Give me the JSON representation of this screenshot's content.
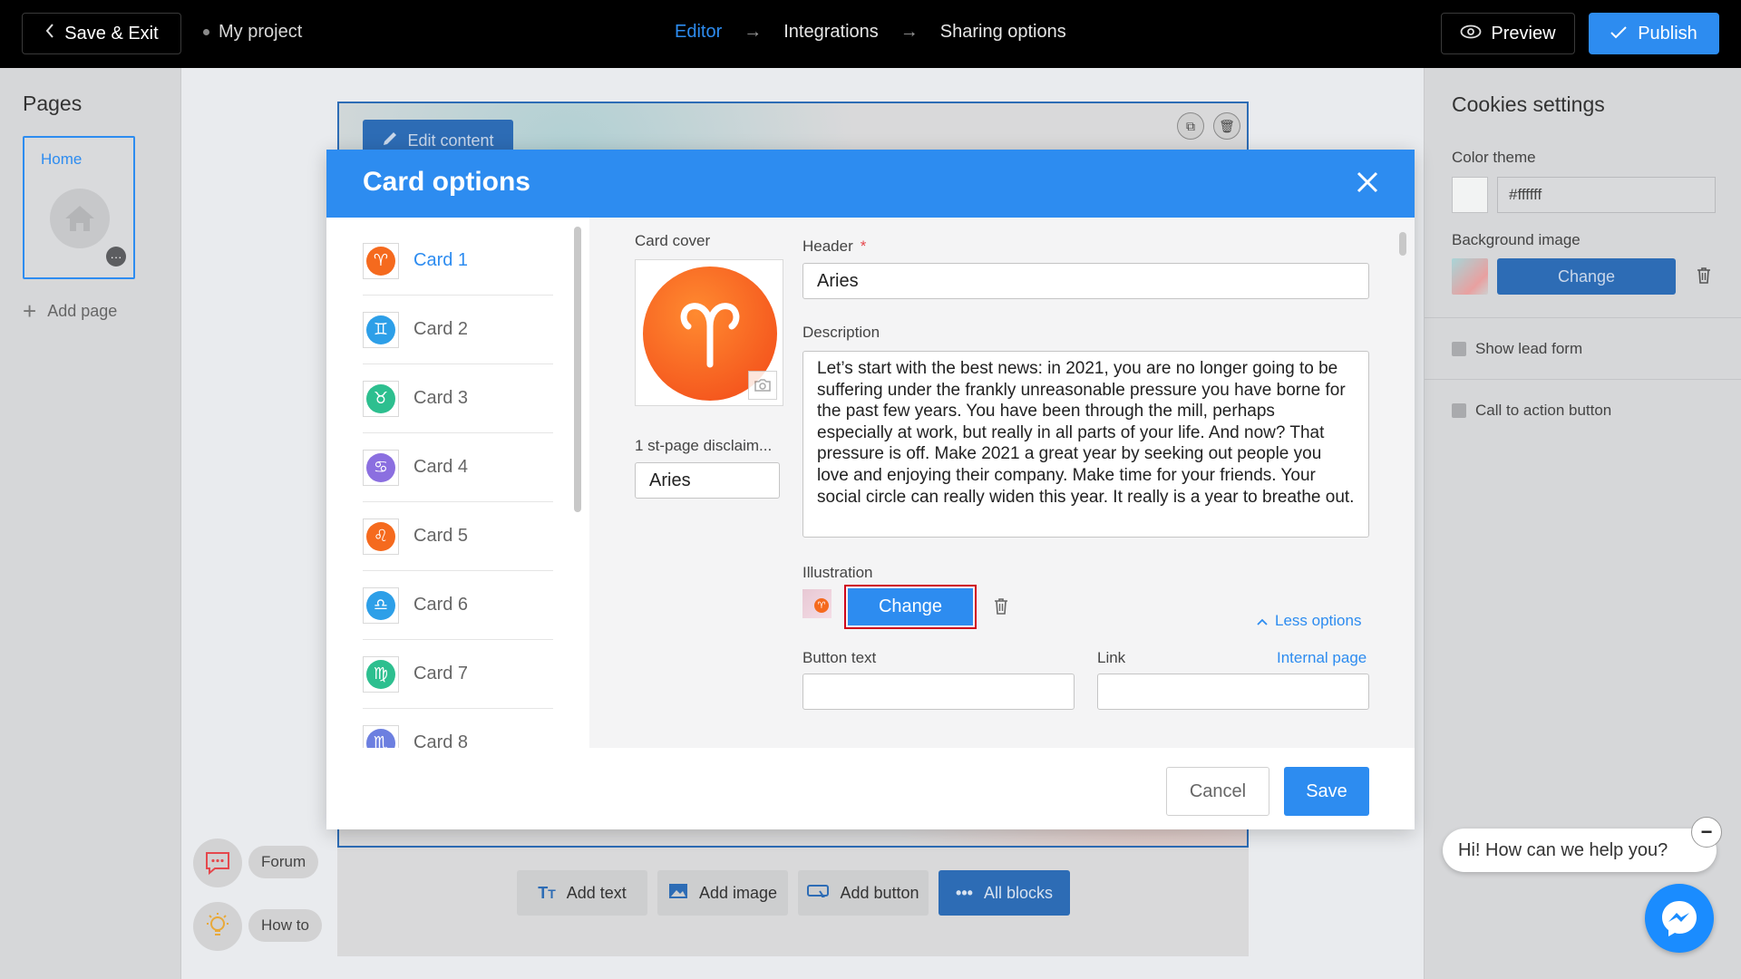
{
  "topbar": {
    "save_exit_label": "Save & Exit",
    "project_name": "My project",
    "steps": [
      "Editor",
      "Integrations",
      "Sharing options"
    ],
    "preview_label": "Preview",
    "publish_label": "Publish"
  },
  "left_sidebar": {
    "title": "Pages",
    "home_label": "Home",
    "add_page_label": "Add page"
  },
  "canvas": {
    "edit_content_label": "Edit content",
    "blocks": [
      {
        "label": "Add text",
        "icon": "text-icon"
      },
      {
        "label": "Add image",
        "icon": "image-icon"
      },
      {
        "label": "Add button",
        "icon": "button-icon"
      },
      {
        "label": "All blocks",
        "icon": "dots-icon"
      }
    ]
  },
  "help": {
    "forum_label": "Forum",
    "howto_label": "How to"
  },
  "right_sidebar": {
    "title": "Cookies settings",
    "color_theme_label": "Color theme",
    "color_value": "#ffffff",
    "background_image_label": "Background image",
    "change_label": "Change",
    "show_lead_form_label": "Show lead form",
    "cta_label": "Call to action button"
  },
  "chat": {
    "prompt": "Hi! How can we help you?"
  },
  "modal": {
    "title": "Card options",
    "cards": [
      {
        "label": "Card 1",
        "symbol": "♈",
        "color": "#f56a1e",
        "active": true
      },
      {
        "label": "Card 2",
        "symbol": "♊",
        "color": "#2d9fe8"
      },
      {
        "label": "Card 3",
        "symbol": "♉",
        "color": "#2dbf8f"
      },
      {
        "label": "Card 4",
        "symbol": "♋",
        "color": "#8b6fe0"
      },
      {
        "label": "Card 5",
        "symbol": "♌",
        "color": "#f56a1e"
      },
      {
        "label": "Card 6",
        "symbol": "♎",
        "color": "#2d9fe8"
      },
      {
        "label": "Card 7",
        "symbol": "♍",
        "color": "#2dbf8f"
      },
      {
        "label": "Card 8",
        "symbol": "♏",
        "color": "#6c7fe0"
      }
    ],
    "card_cover_label": "Card cover",
    "disclaimer_label": "1 st-page disclaim...",
    "disclaimer_value": "Aries",
    "header_label": "Header",
    "header_value": "Aries",
    "description_label": "Description",
    "description_value": "Let’s start with the best news: in 2021, you are no longer going to be suffering under the frankly unreasonable pressure you have borne for the past few years. You have been through the mill, perhaps especially at work, but really in all parts of your life. And now? That pressure is off. Make 2021 a great year by seeking out people you love and enjoying their company. Make time for your friends. Your social circle can really widen this year. It really is a year to breathe out.",
    "illustration_label": "Illustration",
    "change_label": "Change",
    "less_options_label": "Less options",
    "button_text_label": "Button text",
    "link_label": "Link",
    "internal_page_label": "Internal page",
    "cancel_label": "Cancel",
    "save_label": "Save"
  },
  "colors": {
    "accent": "#2d8cf0",
    "topbar": "#000000",
    "highlight": "#d0021b"
  }
}
